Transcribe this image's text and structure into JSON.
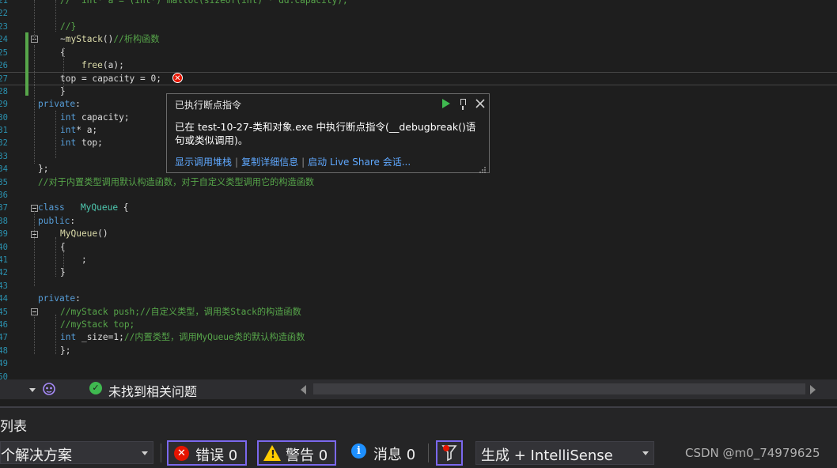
{
  "editor": {
    "lines": [
      {
        "no": "21",
        "html": "<span class=\"c\">//  int* a = (int*) malloc(sizeof(int) * dd.capacity);</span>"
      },
      {
        "no": "22",
        "html": ""
      },
      {
        "no": "23",
        "html": "<span class=\"c\">//}</span>"
      },
      {
        "no": "24",
        "html": "~<span class=\"f\">myStack</span>()<span class=\"c\">//析构函数</span>"
      },
      {
        "no": "25",
        "html": "{"
      },
      {
        "no": "26",
        "html": "    <span class=\"f\">free</span>(a);"
      },
      {
        "no": "27",
        "html": "top = capacity = 0;"
      },
      {
        "no": "28",
        "html": "}"
      },
      {
        "no": "29",
        "html": "<span class=\"k\">private</span>:"
      },
      {
        "no": "30",
        "html": "<span class=\"k\">int</span> capacity;"
      },
      {
        "no": "31",
        "html": "<span class=\"k\">int</span>* a;"
      },
      {
        "no": "32",
        "html": "<span class=\"k\">int</span> top;"
      },
      {
        "no": "33",
        "html": ""
      },
      {
        "no": "34",
        "html": "};"
      },
      {
        "no": "35",
        "html": "<span class=\"c\">//对于内置类型调用默认构造函数，对于自定义类型调用它的构造函数</span>"
      },
      {
        "no": "36",
        "html": ""
      },
      {
        "no": "37",
        "html": "<span class=\"k\">class</span>   <span class=\"t\">MyQueue</span> {"
      },
      {
        "no": "38",
        "html": "<span class=\"k\">public</span>:"
      },
      {
        "no": "39",
        "html": "<span class=\"f\">MyQueue</span>()"
      },
      {
        "no": "40",
        "html": "{"
      },
      {
        "no": "41",
        "html": "    ;"
      },
      {
        "no": "42",
        "html": "}"
      },
      {
        "no": "43",
        "html": ""
      },
      {
        "no": "44",
        "html": "<span class=\"k\">private</span>:"
      },
      {
        "no": "45",
        "html": "<span class=\"c\">//myStack push;//自定义类型，调用类Stack的构造函数</span>"
      },
      {
        "no": "46",
        "html": "<span class=\"c\">//myStack top;</span>"
      },
      {
        "no": "47",
        "html": "<span class=\"k\">int</span> _size=1;<span class=\"c\">//内置类型，调用MyQueue类的默认构造函数</span>"
      },
      {
        "no": "48",
        "html": "};"
      },
      {
        "no": "49",
        "html": ""
      },
      {
        "no": "50",
        "html": ""
      }
    ]
  },
  "popup": {
    "title": "已执行断点指令",
    "message": "已在 test-10-27-类和对象.exe 中执行断点指令(__debugbreak()语句或类似调用)。",
    "links": [
      "显示调用堆栈",
      "复制详细信息",
      "启动 Live Share 会话..."
    ]
  },
  "infobar": {
    "issues_text": "未找到相关问题",
    "icons": [
      "dropdown-arrow-icon",
      "copilot-icon",
      "check-circle-icon",
      "scroll-left-icon",
      "scroll-right-icon"
    ]
  },
  "error_list": {
    "title": "列表",
    "scope": "个解决方案",
    "errors_label": "错误 0",
    "warnings_label": "警告 0",
    "messages_label": "消息 0",
    "build_source": "生成 + IntelliSense"
  },
  "watermark": "CSDN @m0_74979625",
  "colors": {
    "keyword": "#569cd6",
    "type": "#4ec9b0",
    "comment": "#57a64a",
    "function": "#dcdcaa",
    "line_number": "#2b91af",
    "filter_border": "#7b68ee",
    "error": "#e51400",
    "warning": "#ffcc00",
    "info": "#1e90ff"
  }
}
